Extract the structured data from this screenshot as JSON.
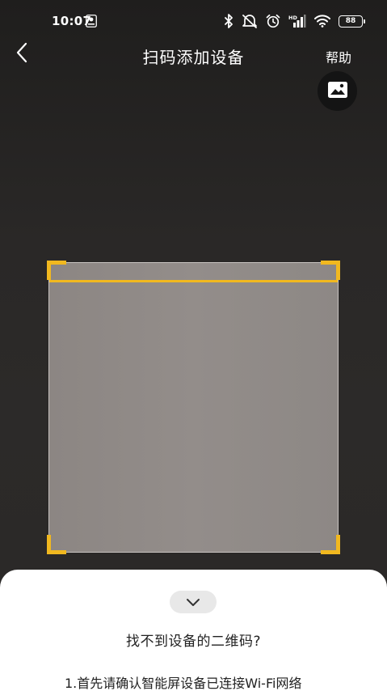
{
  "status_bar": {
    "time": "10:07",
    "battery_level": "88"
  },
  "nav": {
    "title": "扫码添加设备",
    "help_label": "帮助",
    "back_icon": "chevron-left-icon",
    "album_icon": "image-icon"
  },
  "scanner": {
    "accent_color": "#f1b81f"
  },
  "sheet": {
    "collapse_icon": "chevron-down-icon",
    "title": "找不到设备的二维码?",
    "step1": "1.首先请确认智能屏设备已连接Wi-Fi网络"
  }
}
